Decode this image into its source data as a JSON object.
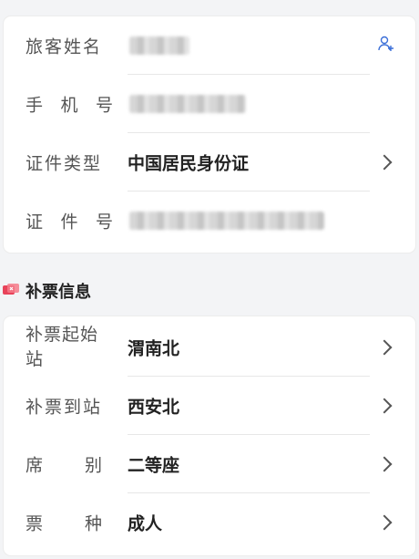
{
  "passenger": {
    "name_label": "旅客姓名",
    "phone_label": [
      "手",
      "机",
      "号"
    ],
    "id_type_label": "证件类型",
    "id_type_value": "中国居民身份证",
    "id_number_label": [
      "证",
      "件",
      "号"
    ]
  },
  "ticket_info": {
    "section_title": "补票信息",
    "start_station_label": "补票起始站",
    "start_station_value": "渭南北",
    "end_station_label": "补票到站",
    "end_station_value": "西安北",
    "seat_label": [
      "席",
      "别"
    ],
    "seat_value": "二等座",
    "ticket_type_label": [
      "票",
      "种"
    ],
    "ticket_type_value": "成人"
  },
  "colors": {
    "accent": "#3b6fd8",
    "section_icon": "#e8435a"
  },
  "icons": {
    "add_passenger": "add-user-icon",
    "chevron": "chevron-right-icon",
    "section": "ticket-icon"
  }
}
